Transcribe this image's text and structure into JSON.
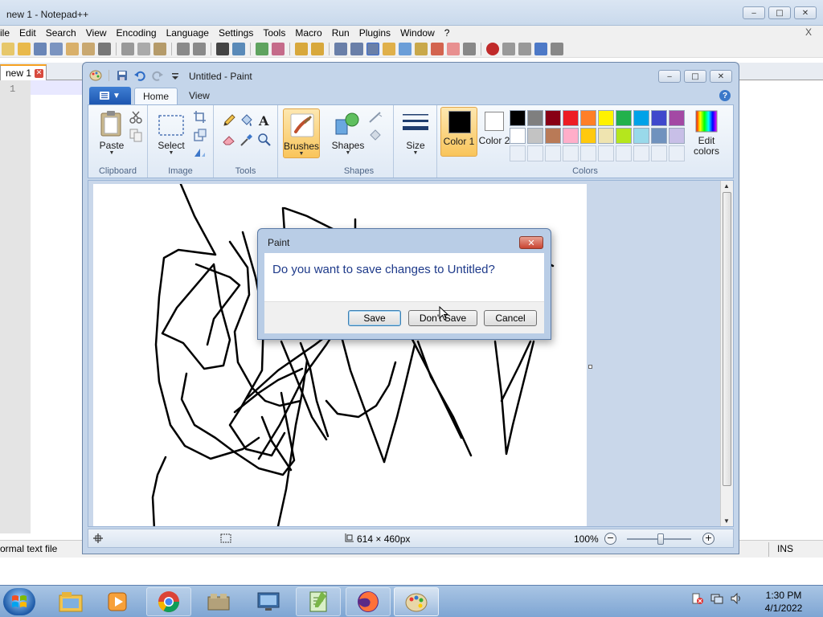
{
  "notepad": {
    "title": "new 1 - Notepad++",
    "menu": [
      "ile",
      "Edit",
      "Search",
      "View",
      "Encoding",
      "Language",
      "Settings",
      "Tools",
      "Macro",
      "Run",
      "Plugins",
      "Window",
      "?"
    ],
    "close_label": "X",
    "tab_label": "new 1",
    "line_number": "1",
    "status_left": "ormal text file",
    "status_right": "INS"
  },
  "paint": {
    "title": "Untitled - Paint",
    "tabs": {
      "home": "Home",
      "view": "View"
    },
    "help": "?",
    "groups": {
      "clipboard": "Clipboard",
      "image": "Image",
      "tools": "Tools",
      "shapes": "Shapes",
      "colors": "Colors"
    },
    "buttons": {
      "paste": "Paste",
      "select": "Select",
      "brushes": "Brushes",
      "shapes": "Shapes",
      "size": "Size",
      "color1": "Color 1",
      "color2": "Color 2",
      "edit_colors": "Edit colors"
    },
    "active_color1": "#000000",
    "active_color2": "#ffffff",
    "palette_row1": [
      "#000000",
      "#7f7f7f",
      "#880015",
      "#ed1c24",
      "#ff7f27",
      "#fff200",
      "#22b14c",
      "#00a2e8",
      "#3f48cc",
      "#a349a4"
    ],
    "palette_row2": [
      "#ffffff",
      "#c3c3c3",
      "#b97a57",
      "#ffaec9",
      "#ffc90e",
      "#efe4b0",
      "#b5e61d",
      "#99d9ea",
      "#7092be",
      "#c8bfe7"
    ],
    "status": {
      "dimensions": "614 × 460px",
      "zoom": "100%"
    }
  },
  "dialog": {
    "title": "Paint",
    "message": "Do you want to save changes to Untitled?",
    "save": "Save",
    "dont_save": "Don't Save",
    "cancel": "Cancel"
  },
  "taskbar": {
    "time": "1:30 PM",
    "date": "4/1/2022",
    "apps": [
      "explorer-icon",
      "media-player-icon",
      "chrome-icon",
      "network-icon",
      "remote-desktop-icon",
      "notepad-plus-plus-icon",
      "firefox-icon",
      "paint-icon"
    ]
  }
}
